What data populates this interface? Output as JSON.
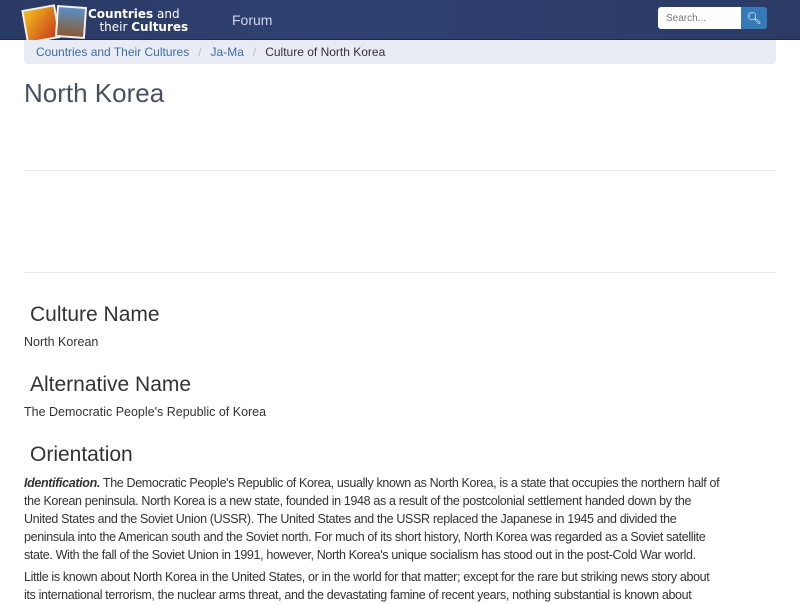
{
  "nav": {
    "logo_line1_bold": "Countries",
    "logo_line1": " and",
    "logo_line2": "their ",
    "logo_line2_bold": "Cultures",
    "forum": "Forum",
    "search_placeholder": "Search...",
    "search_icon": "search-icon"
  },
  "breadcrumb": [
    "Countries and Their Cultures",
    "Ja-Ma",
    "Culture of North Korea"
  ],
  "title": "North Korea",
  "sections": [
    {
      "heading": "Culture Name",
      "text": "North Korean"
    },
    {
      "heading": "Alternative Name",
      "text": "The Democratic People's Republic of Korea"
    },
    {
      "heading": "Orientation"
    }
  ],
  "orientation": {
    "lead": "Identification.",
    "p1_lines": [
      " The Democratic People's Republic of Korea, usually known as North Korea, is a state that occupies the northern half of",
      "the Korean peninsula. North Korea is a new state, founded in 1948 as a result of the postcolonial settlement handed down by the",
      "United States and the Soviet Union (USSR). The United States and the USSR replaced the Japanese in 1945 and divided the",
      "peninsula into the American south and the Soviet north. For much of its short history, North Korea was regarded as a Soviet satellite",
      "state. With the fall of the Soviet Union in 1991, however, North Korea's unique socialism has stood out in the post-Cold War world."
    ],
    "p2_lines": [
      "Little is known about North Korea in the United States, or in the world for that matter; except for the rare but striking news story about",
      "its international terrorism, the nuclear arms threat, and the devastating famine of recent years, nothing substantial is known about"
    ]
  }
}
